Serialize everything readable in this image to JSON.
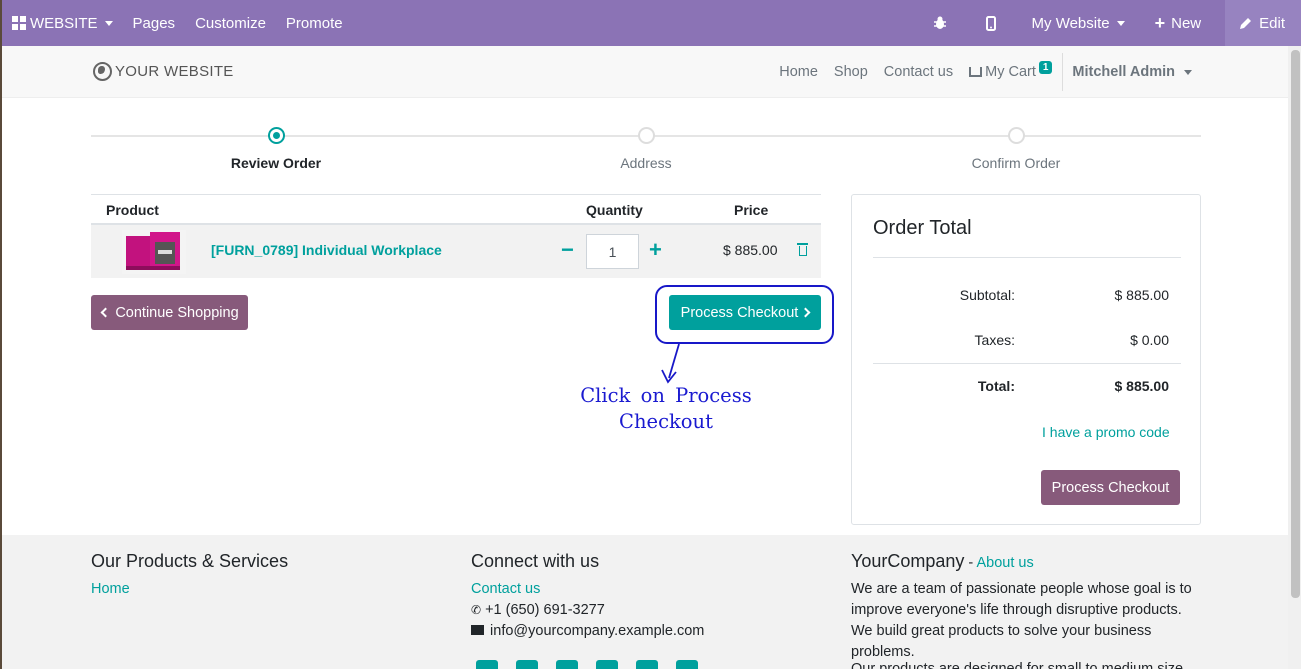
{
  "admin_bar": {
    "website_label": "WEBSITE",
    "pages_label": "Pages",
    "customize_label": "Customize",
    "promote_label": "Promote",
    "my_website_label": "My Website",
    "new_label": "New",
    "edit_label": "Edit",
    "background_color": "#8b73b5"
  },
  "header": {
    "logo_text": "YOUR WEBSITE",
    "nav": {
      "home": "Home",
      "shop": "Shop",
      "contact": "Contact us",
      "cart": "My Cart",
      "cart_count": "1",
      "user": "Mitchell Admin"
    }
  },
  "wizard": {
    "steps": [
      {
        "label": "Review Order",
        "active": true
      },
      {
        "label": "Address",
        "active": false
      },
      {
        "label": "Confirm Order",
        "active": false
      }
    ]
  },
  "cart": {
    "headers": {
      "product": "Product",
      "quantity": "Quantity",
      "price": "Price"
    },
    "items": [
      {
        "name": "[FURN_0789] Individual Workplace",
        "quantity": "1",
        "price": "$ 885.00"
      }
    ],
    "continue_label": "Continue Shopping",
    "checkout_label": "Process Checkout"
  },
  "annotation": {
    "text": "Click on Process Checkout"
  },
  "order_total": {
    "title": "Order Total",
    "subtotal_label": "Subtotal:",
    "subtotal_value": "$ 885.00",
    "taxes_label": "Taxes:",
    "taxes_value": "$ 0.00",
    "total_label": "Total:",
    "total_value": "$ 885.00",
    "promo_label": "I have a promo code",
    "checkout_label": "Process Checkout"
  },
  "footer": {
    "col1_title": "Our Products & Services",
    "col1_link": "Home",
    "col2_title": "Connect with us",
    "col2_contact": "Contact us",
    "col2_phone": "+1 (650) 691-3277",
    "col2_email": "info@yourcompany.example.com",
    "col3_company": "YourCompany",
    "col3_separator": " - ",
    "col3_about": "About us",
    "col3_text": "We are a team of passionate people whose goal is to improve everyone's life through disruptive products. We build great products to solve your business problems.",
    "col3_text2": "Our products are designed for small to medium size"
  },
  "colors": {
    "primary": "#00a09d",
    "secondary": "#875a7b",
    "annotation": "#1a1ad0"
  }
}
